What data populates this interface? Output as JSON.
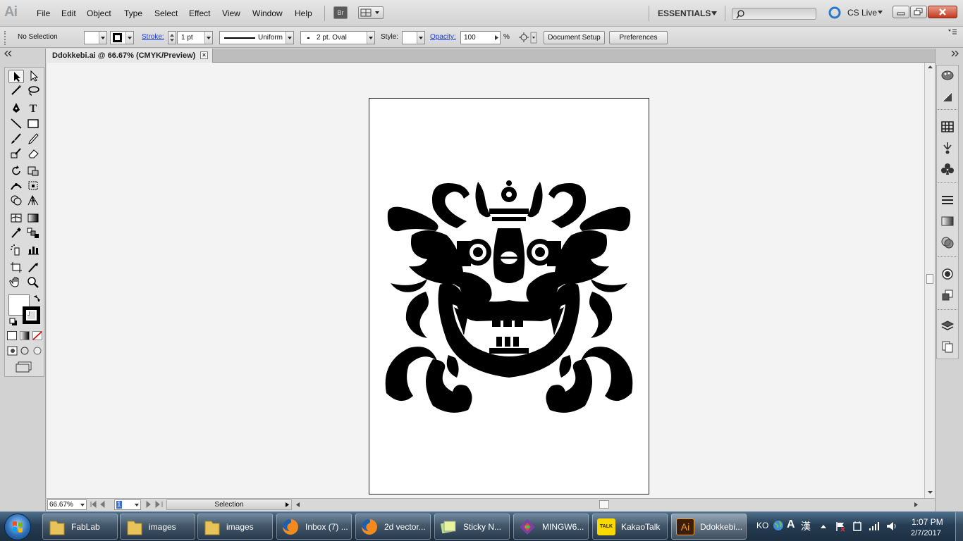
{
  "app": {
    "logo": "Ai"
  },
  "menu": [
    "File",
    "Edit",
    "Object",
    "Type",
    "Select",
    "Effect",
    "View",
    "Window",
    "Help"
  ],
  "header": {
    "bridge_label": "Br",
    "workspace": "ESSENTIALS",
    "cs_live": "CS Live",
    "search_placeholder": ""
  },
  "control": {
    "selection": "No Selection",
    "stroke_label": "Stroke:",
    "stroke_weight": "1 pt",
    "profile": "Uniform",
    "brush": "2 pt. Oval",
    "style_label": "Style:",
    "opacity_label": "Opacity:",
    "opacity_value": "100",
    "opacity_unit": "%",
    "document_setup": "Document Setup",
    "preferences": "Preferences"
  },
  "document": {
    "tab_title": "Ddokkebi.ai @ 66.67% (CMYK/Preview)",
    "close": "×"
  },
  "status": {
    "zoom": "66.67%",
    "artboard_index": "1",
    "tool_status": "Selection"
  },
  "taskbar": {
    "items": [
      {
        "label": "FabLab",
        "icon": "folder-icon"
      },
      {
        "label": "images",
        "icon": "folder-icon"
      },
      {
        "label": "images",
        "icon": "folder-icon"
      },
      {
        "label": "Inbox (7) ...",
        "icon": "firefox-icon"
      },
      {
        "label": "2d vector...",
        "icon": "firefox-icon"
      },
      {
        "label": "Sticky N...",
        "icon": "sticky-notes-icon"
      },
      {
        "label": "MINGW6...",
        "icon": "git-icon"
      },
      {
        "label": "KakaoTalk",
        "icon": "kakaotalk-icon"
      },
      {
        "label": "Ddokkebi...",
        "icon": "illustrator-icon"
      }
    ],
    "kakao_badge": "TALK",
    "ai_badge": "Ai",
    "language": "KO",
    "ime_mode": "A",
    "hanja": "漢",
    "time": "1:07 PM",
    "date": "2/7/2017"
  },
  "colors": {
    "accent_link": "#1a3fd0",
    "artwork": "#000000"
  }
}
